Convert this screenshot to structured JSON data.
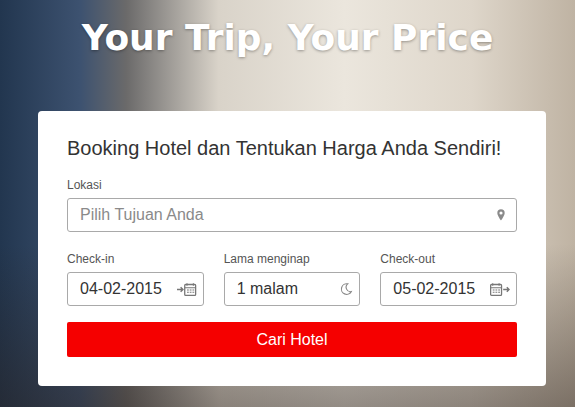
{
  "hero": {
    "title": "Your Trip, Your Price"
  },
  "form": {
    "heading": "Booking Hotel dan Tentukan Harga Anda Sendiri!",
    "location": {
      "label": "Lokasi",
      "placeholder": "Pilih Tujuan Anda"
    },
    "fields": [
      {
        "label": "Check-in",
        "value": "04-02-2015",
        "kind": "checkin"
      },
      {
        "label": "Lama menginap",
        "value": "1 malam",
        "kind": "nights"
      },
      {
        "label": "Check-out",
        "value": "05-02-2015",
        "kind": "checkout"
      }
    ],
    "button": "Cari Hotel"
  }
}
